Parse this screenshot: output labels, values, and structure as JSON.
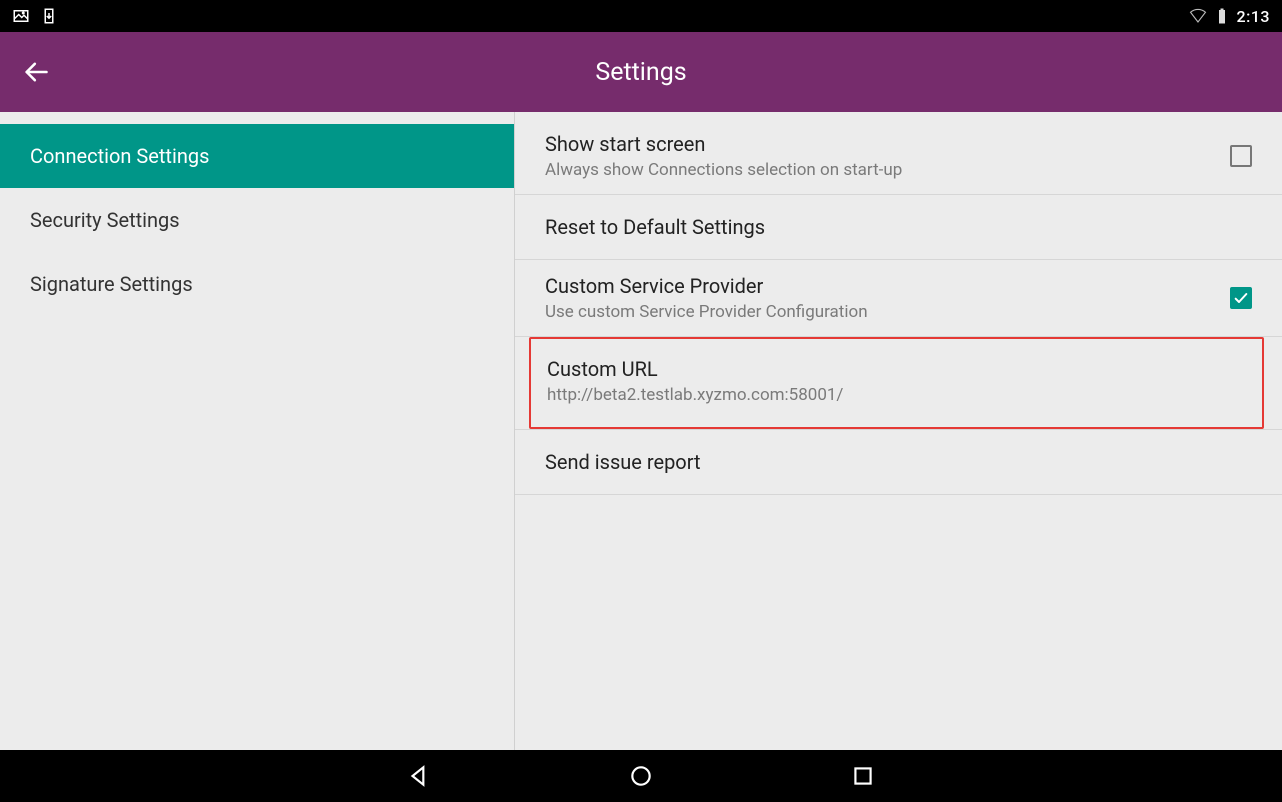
{
  "statusbar": {
    "time": "2:13"
  },
  "appbar": {
    "title": "Settings"
  },
  "sidebar": {
    "items": [
      {
        "label": "Connection Settings"
      },
      {
        "label": "Security Settings"
      },
      {
        "label": "Signature Settings"
      }
    ]
  },
  "content": {
    "show_start_screen": {
      "title": "Show start screen",
      "subtitle": "Always show Connections selection on start-up",
      "checked": false
    },
    "reset_defaults": {
      "title": "Reset to Default Settings"
    },
    "custom_provider": {
      "title": "Custom Service Provider",
      "subtitle": "Use custom Service Provider Configuration",
      "checked": true
    },
    "custom_url": {
      "title": "Custom URL",
      "subtitle": "http://beta2.testlab.xyzmo.com:58001/"
    },
    "send_report": {
      "title": "Send issue report"
    }
  }
}
